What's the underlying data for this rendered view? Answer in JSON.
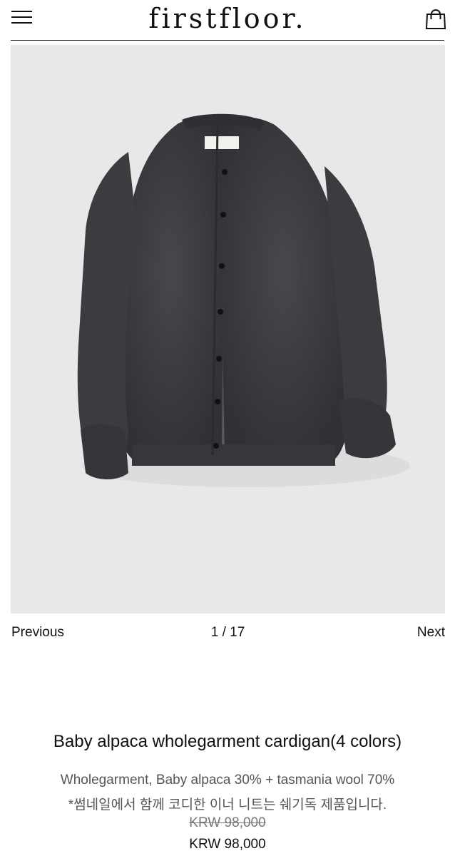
{
  "header": {
    "logo": "firstfloor.",
    "menu_icon": "hamburger-menu-icon",
    "cart_icon": "shopping-bag-icon"
  },
  "gallery": {
    "previous_label": "Previous",
    "counter": "1 / 17",
    "next_label": "Next",
    "current_index": 1,
    "total": 17
  },
  "product": {
    "title": "Baby alpaca wholegarment cardigan(4 colors)",
    "description_line1": "Wholegarment, Baby alpaca 30% + tasmania wool 70%",
    "description_line2": "*썸네일에서 함께 코디한 이너 니트는 쉐기독 제품입니다.",
    "original_price": "KRW 98,000",
    "price": "KRW 98,000"
  },
  "colors": {
    "image_background": "#e8e8e8",
    "cardigan": "#3a3c40"
  }
}
